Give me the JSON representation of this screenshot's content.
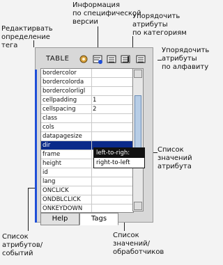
{
  "callouts": {
    "edit_tag": "Редактирвать\nопределение\nтега",
    "specific_info": "Информация\nпо специфической\nверсии",
    "sort_by_category": "Упорядочить\nатрибуты\nпо категориям",
    "sort_alpha": "Упорядочить\nатрибуты\nпо алфавиту",
    "value_list": "Список\nзначений\nатрибута",
    "attr_events": "Список\nатрибутов/\nсобытий",
    "values_handlers": "Список\nзначений/\nобработчиков"
  },
  "toolbar": {
    "title": "TABLE"
  },
  "rows": [
    {
      "attr": "bordercolor",
      "value": ""
    },
    {
      "attr": "bordercolorda",
      "value": ""
    },
    {
      "attr": "bordercolorligl",
      "value": ""
    },
    {
      "attr": "cellpadding",
      "value": "1"
    },
    {
      "attr": "cellspacing",
      "value": "2"
    },
    {
      "attr": "class",
      "value": ""
    },
    {
      "attr": "cols",
      "value": ""
    },
    {
      "attr": "datapagesize",
      "value": ""
    },
    {
      "attr": "dir",
      "value": ""
    },
    {
      "attr": "frame",
      "value": ""
    },
    {
      "attr": "height",
      "value": ""
    },
    {
      "attr": "id",
      "value": ""
    },
    {
      "attr": "lang",
      "value": ""
    },
    {
      "attr": "ONCLICK",
      "value": ""
    },
    {
      "attr": "ONDBLCLICK",
      "value": ""
    },
    {
      "attr": "ONKEYDOWN",
      "value": ""
    }
  ],
  "dropdown": {
    "items": [
      "left-to-righ:",
      "right-to-left"
    ]
  },
  "tabs": [
    {
      "label": "Help"
    },
    {
      "label": "Tags"
    }
  ]
}
